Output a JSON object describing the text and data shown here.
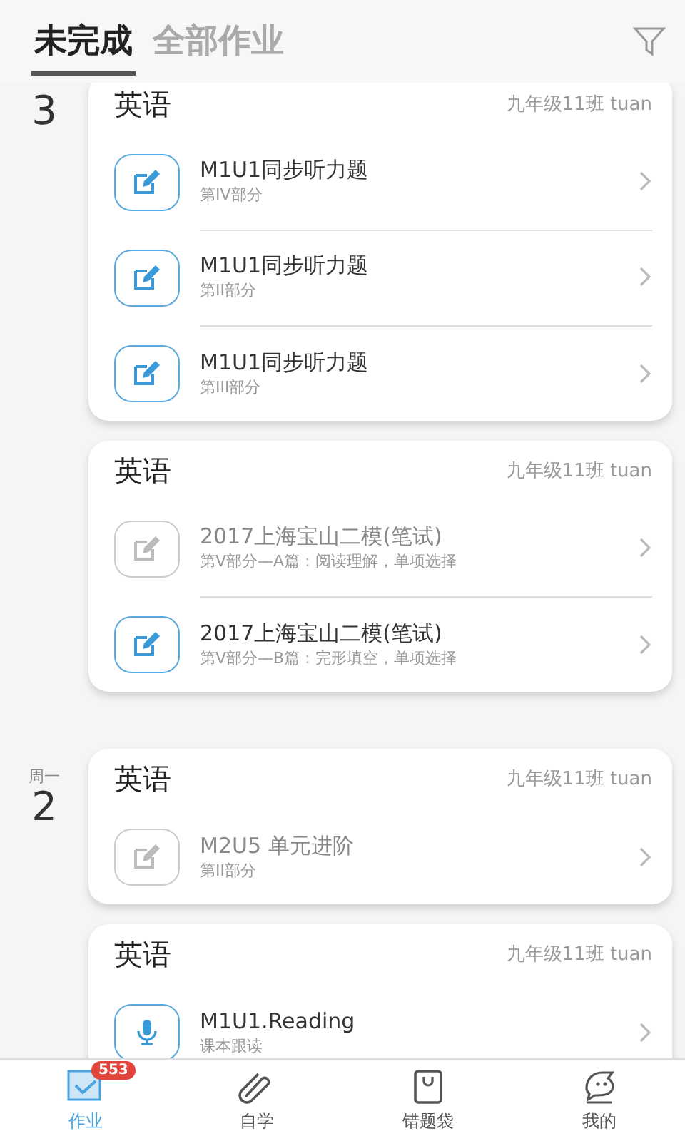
{
  "tabs": [
    {
      "label": "未完成",
      "selected": true
    },
    {
      "label": "全部作业",
      "selected": false
    }
  ],
  "groups": [
    {
      "day": "3",
      "cards": [
        {
          "subject": "英语",
          "class": "九年级11班 tuan",
          "items": [
            {
              "kind": "edit",
              "active": true,
              "title": "M1U1同步听力题",
              "subtitle": "第IV部分"
            },
            {
              "kind": "edit",
              "active": true,
              "title": "M1U1同步听力题",
              "subtitle": "第II部分"
            },
            {
              "kind": "edit",
              "active": true,
              "title": "M1U1同步听力题",
              "subtitle": "第III部分"
            }
          ]
        },
        {
          "subject": "英语",
          "class": "九年级11班 tuan",
          "items": [
            {
              "kind": "edit",
              "active": false,
              "title": "2017上海宝山二模(笔试)",
              "subtitle": "第V部分—A篇：阅读理解，单项选择"
            },
            {
              "kind": "edit",
              "active": true,
              "title": "2017上海宝山二模(笔试)",
              "subtitle": "第V部分—B篇：完形填空，单项选择"
            }
          ]
        }
      ]
    },
    {
      "weekday": "周一",
      "day": "2",
      "cards": [
        {
          "subject": "英语",
          "class": "九年级11班 tuan",
          "items": [
            {
              "kind": "edit",
              "active": false,
              "title": "M2U5 单元进阶",
              "subtitle": "第II部分"
            }
          ]
        },
        {
          "subject": "英语",
          "class": "九年级11班 tuan",
          "items": [
            {
              "kind": "mic",
              "active": true,
              "title": "M1U1.Reading",
              "subtitle": "课本跟读"
            }
          ]
        }
      ]
    }
  ],
  "nav": [
    {
      "kind": "homework",
      "label": "作业",
      "selected": true,
      "badge": "553"
    },
    {
      "kind": "study",
      "label": "自学",
      "selected": false
    },
    {
      "kind": "bag",
      "label": "错题袋",
      "selected": false
    },
    {
      "kind": "me",
      "label": "我的",
      "selected": false
    }
  ]
}
